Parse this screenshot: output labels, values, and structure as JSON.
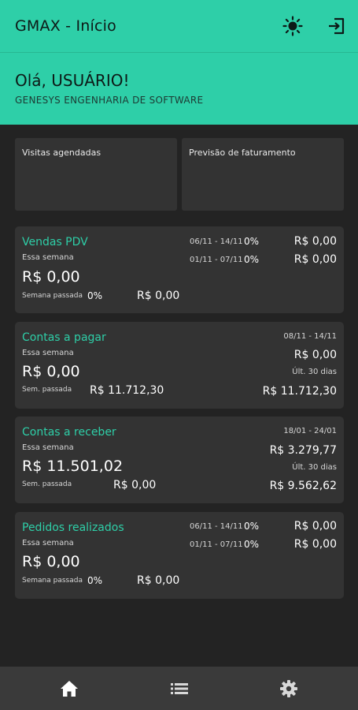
{
  "appbar": {
    "title": "GMAX - Início",
    "theme_icon": "sun-icon",
    "exit_icon": "logout-icon"
  },
  "greeting": {
    "title": "Olá, USUÁRIO!",
    "subtitle": "GENESYS ENGENHARIA DE SOFTWARE"
  },
  "tiles": [
    {
      "label": "Visitas agendadas"
    },
    {
      "label": "Previsão de faturamento"
    }
  ],
  "vendas": {
    "title": "Vendas PDV",
    "week_label": "Essa semana",
    "week_value": "R$ 0,00",
    "last_label": "Semana passada",
    "last_pct": "0%",
    "last_value": "R$ 0,00",
    "row1": {
      "range": "06/11 - 14/11",
      "pct": "0%",
      "value": "R$ 0,00"
    },
    "row2": {
      "range": "01/11 - 07/11",
      "pct": "0%",
      "value": "R$ 0,00"
    }
  },
  "pagar": {
    "title": "Contas a pagar",
    "range": "08/11 - 14/11",
    "week_label": "Essa semana",
    "week_value": "R$ 0,00",
    "right_value": "R$ 0,00",
    "last30_label": "Últ. 30 dias",
    "last_label": "Sem. passada",
    "last_value": "R$ 11.712,30",
    "last30_value": "R$ 11.712,30"
  },
  "receber": {
    "title": "Contas a receber",
    "range": "18/01 - 24/01",
    "week_label": "Essa semana",
    "week_value": "R$ 11.501,02",
    "right_value": "R$ 3.279,77",
    "last30_label": "Últ. 30 dias",
    "last_label": "Sem. passada",
    "last_value": "R$ 0,00",
    "last30_value": "R$ 9.562,62"
  },
  "pedidos": {
    "title": "Pedidos realizados",
    "week_label": "Essa semana",
    "week_value": "R$ 0,00",
    "last_label": "Semana passada",
    "last_pct": "0%",
    "last_value": "R$ 0,00",
    "row1": {
      "range": "06/11 - 14/11",
      "pct": "0%",
      "value": "R$ 0,00"
    },
    "row2": {
      "range": "01/11 - 07/11",
      "pct": "0%",
      "value": "R$ 0,00"
    }
  },
  "nav": {
    "items": [
      "home-icon",
      "list-icon",
      "settings-icon"
    ],
    "active": "home-icon"
  },
  "colors": {
    "accent": "#2ecfa8",
    "background": "#232323",
    "card": "#333333"
  }
}
